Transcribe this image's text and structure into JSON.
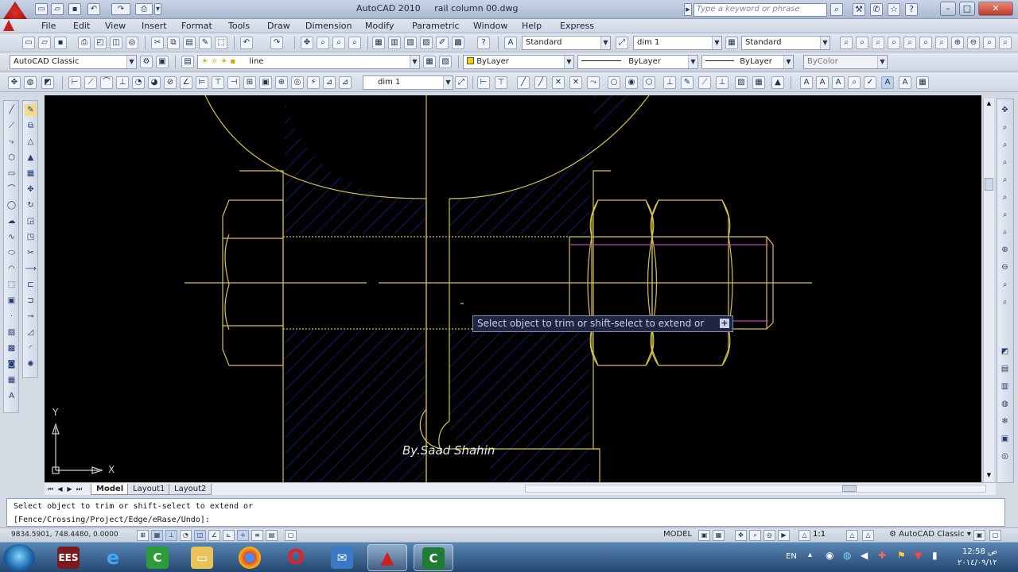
{
  "window": {
    "app_title": "AutoCAD 2010",
    "doc_title": "rail column 00.dwg",
    "search_placeholder": "Type a keyword or phrase"
  },
  "menu": [
    "File",
    "Edit",
    "View",
    "Insert",
    "Format",
    "Tools",
    "Draw",
    "Dimension",
    "Modify",
    "Parametric",
    "Window",
    "Help",
    "Express"
  ],
  "toolbar2": {
    "text_style": "Standard",
    "dim_style": "dim 1",
    "table_style": "Standard"
  },
  "toolbar3": {
    "workspace": "AutoCAD Classic",
    "layer": "line",
    "color": "ByLayer",
    "linetype": "ByLayer",
    "lineweight": "ByLayer",
    "plotstyle": "ByColor"
  },
  "toolbar4": {
    "dim_style": "dim 1"
  },
  "canvas": {
    "tooltip": "Select object to trim or shift-select to extend or",
    "watermark": "By.Saad Shahin",
    "ucs_x": "X",
    "ucs_y": "Y"
  },
  "tabs": [
    "Model",
    "Layout1",
    "Layout2"
  ],
  "command": {
    "line1": "Select object to trim or shift-select to extend or",
    "line2": "[Fence/Crossing/Project/Edge/eRase/Undo]:"
  },
  "status": {
    "coords": "9834.5901, 748.4480, 0.0000",
    "model": "MODEL",
    "scale": "1:1",
    "workspace": "AutoCAD Classic"
  },
  "taskbar": {
    "lang": "EN",
    "time": "12:58 ص",
    "date": "٢٠١٤/٠٩/١٢"
  },
  "colors": {
    "drawing_line": "#d8c34a",
    "hatch": "#2430c8",
    "centerline_nut": "#c13bc8",
    "canvas_bg": "#000000"
  }
}
